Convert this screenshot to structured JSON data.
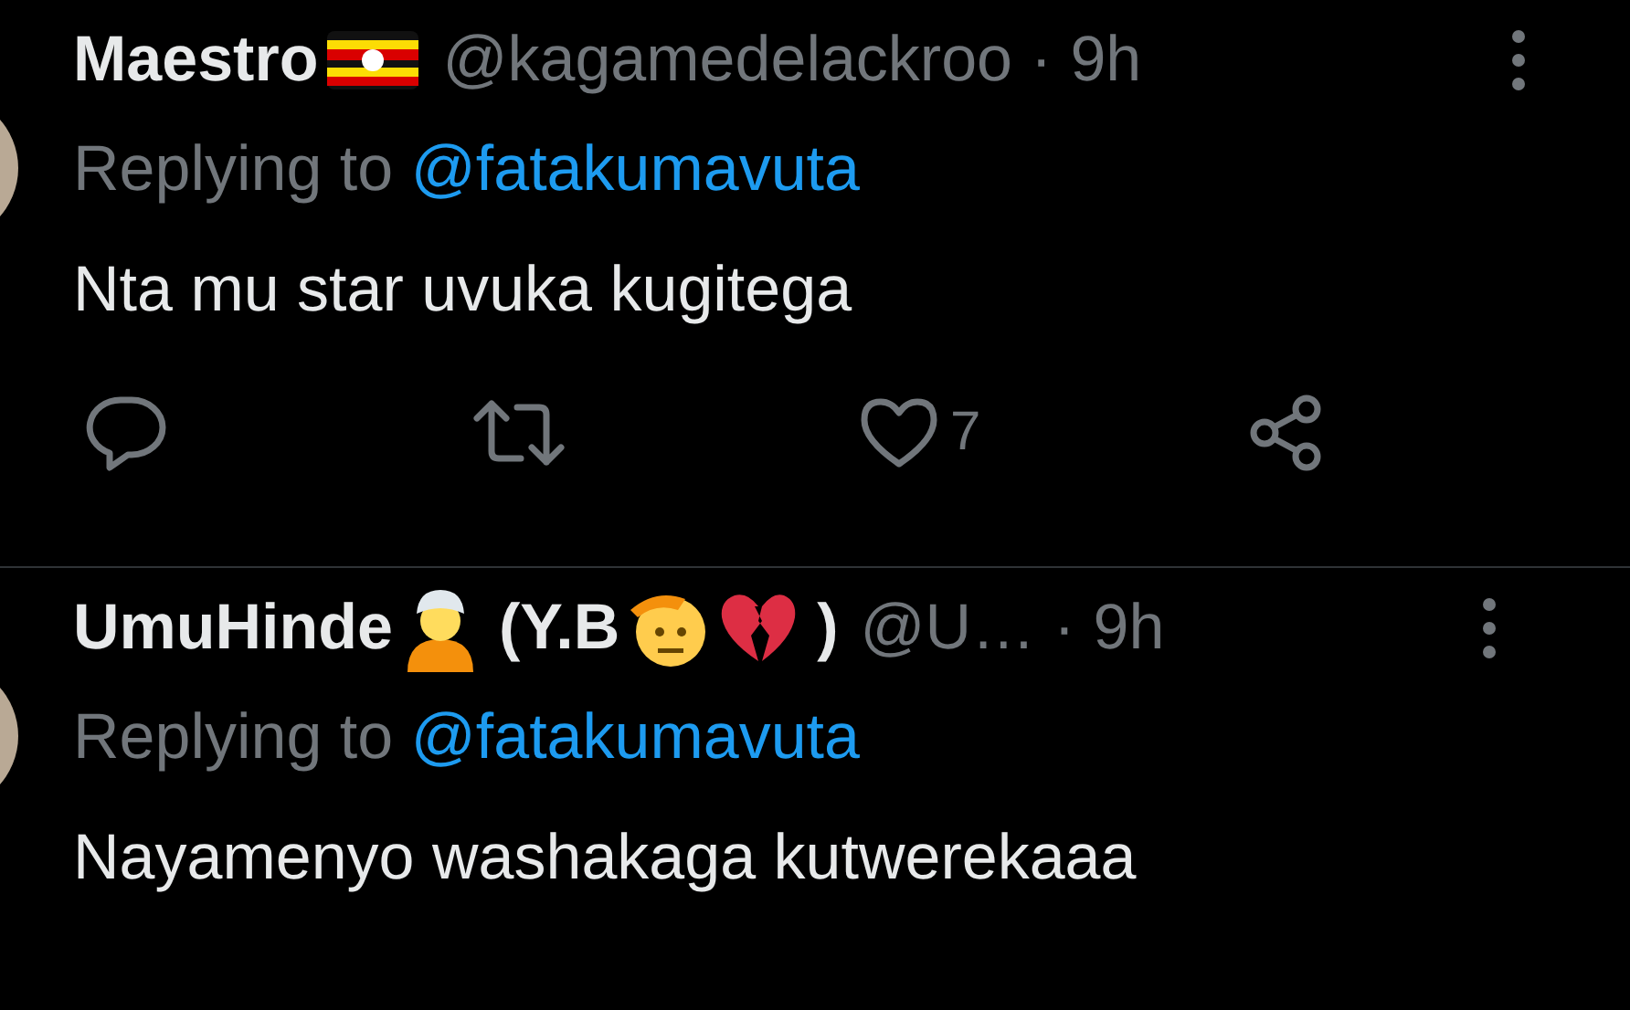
{
  "tweets": [
    {
      "name_parts": [
        {
          "kind": "text",
          "text": "Maestro"
        },
        {
          "kind": "flag"
        }
      ],
      "handle": "@kagamedelackroo",
      "separator": "·",
      "time": "9h",
      "replying_label": "Replying to",
      "replying_handle": "@fatakumavuta",
      "body": "Nta mu star uvuka kugitega",
      "actions": [
        {
          "kind": "reply"
        },
        {
          "kind": "retweet"
        },
        {
          "kind": "like",
          "count": "7"
        },
        {
          "kind": "share"
        }
      ]
    },
    {
      "name_parts": [
        {
          "kind": "text",
          "text": "UmuHinde"
        },
        {
          "kind": "person"
        },
        {
          "kind": "text",
          "text": "(Y.B"
        },
        {
          "kind": "salute"
        },
        {
          "kind": "broken_heart"
        },
        {
          "kind": "text",
          "text": ")"
        }
      ],
      "handle": "@U…",
      "separator": "·",
      "time": "9h",
      "replying_label": "Replying to",
      "replying_handle": "@fatakumavuta",
      "body": "Nayamenyo washakaga kutwerekaaa"
    }
  ]
}
